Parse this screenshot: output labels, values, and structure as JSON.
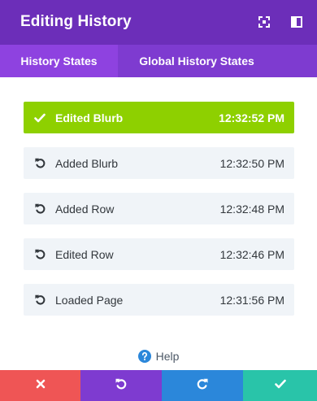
{
  "header": {
    "title": "Editing History",
    "icons": [
      "expand-icon",
      "split-view-icon"
    ]
  },
  "tabs": [
    {
      "label": "History States",
      "active": true
    },
    {
      "label": "Global History States",
      "active": false
    }
  ],
  "states": [
    {
      "label": "Edited Blurb",
      "time": "12:32:52 PM",
      "active": true,
      "icon": "checkmark-icon"
    },
    {
      "label": "Added Blurb",
      "time": "12:32:50 PM",
      "active": false,
      "icon": "undo-icon"
    },
    {
      "label": "Added Row",
      "time": "12:32:48 PM",
      "active": false,
      "icon": "undo-icon"
    },
    {
      "label": "Edited Row",
      "time": "12:32:46 PM",
      "active": false,
      "icon": "undo-icon"
    },
    {
      "label": "Loaded Page",
      "time": "12:31:56 PM",
      "active": false,
      "icon": "undo-icon"
    }
  ],
  "help": {
    "label": "Help",
    "icon": "help-icon"
  },
  "footer": {
    "buttons": [
      {
        "name": "cancel",
        "icon": "close-icon",
        "color": "#ef5555"
      },
      {
        "name": "undo",
        "icon": "undo-icon",
        "color": "#7e3bd0"
      },
      {
        "name": "redo",
        "icon": "redo-icon",
        "color": "#2b87da"
      },
      {
        "name": "save",
        "icon": "checkmark-icon",
        "color": "#29c4a9"
      }
    ]
  },
  "colors": {
    "header_bg": "#6c2eb9",
    "tabs_bg": "#7e3bd0",
    "active_tab_bg": "#8e42e0",
    "active_state_bg": "#8ed000",
    "state_bg": "#f0f4f8",
    "help_icon": "#2b87da"
  }
}
